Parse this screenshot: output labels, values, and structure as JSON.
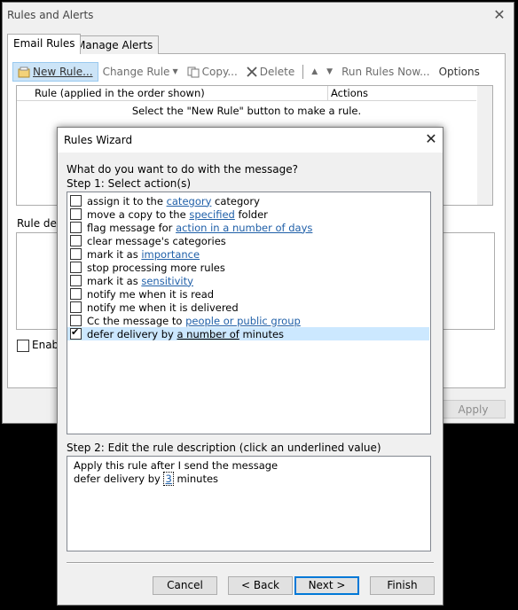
{
  "outer": {
    "title": "Rules and Alerts",
    "close": "✕",
    "tabs": [
      "Email Rules",
      "Manage Alerts"
    ],
    "toolbar": {
      "new_rule": "New Rule...",
      "change_rule": "Change Rule",
      "copy": "Copy...",
      "delete": "Delete",
      "run_rules": "Run Rules Now...",
      "options": "Options"
    },
    "columns": [
      "Rule (applied in the order shown)",
      "Actions"
    ],
    "empty_message": "Select the \"New Rule\" button to make a rule.",
    "rule_desc_label": "Rule des",
    "enable_label": "Enabl",
    "apply": "Apply"
  },
  "wizard": {
    "title": "Rules Wizard",
    "close": "✕",
    "question": "What do you want to do with the message?",
    "step1": "Step 1: Select action(s)",
    "actions": [
      {
        "pre": "assign it to the ",
        "link": "category",
        "post": " category",
        "checked": false
      },
      {
        "pre": "move a copy to the ",
        "link": "specified",
        "post": " folder",
        "checked": false
      },
      {
        "pre": "flag message for ",
        "link": "action in a number of days",
        "post": "",
        "checked": false
      },
      {
        "pre": "clear message's categories",
        "link": "",
        "post": "",
        "checked": false
      },
      {
        "pre": "mark it as ",
        "link": "importance",
        "post": "",
        "checked": false
      },
      {
        "pre": "stop processing more rules",
        "link": "",
        "post": "",
        "checked": false
      },
      {
        "pre": "mark it as ",
        "link": "sensitivity",
        "post": "",
        "checked": false
      },
      {
        "pre": "notify me when it is read",
        "link": "",
        "post": "",
        "checked": false
      },
      {
        "pre": "notify me when it is delivered",
        "link": "",
        "post": "",
        "checked": false
      },
      {
        "pre": "Cc the message to ",
        "link": "people or public group",
        "post": "",
        "checked": false
      },
      {
        "pre": "defer delivery by ",
        "link": "a number of",
        "post": " minutes",
        "checked": true
      }
    ],
    "step2": "Step 2: Edit the rule description (click an underlined value)",
    "desc_line1": "Apply this rule after I send the message",
    "desc_line2_pre": "defer delivery by ",
    "desc_line2_value": "3",
    "desc_line2_post": " minutes",
    "buttons": {
      "cancel": "Cancel",
      "back": "< Back",
      "next": "Next >",
      "finish": "Finish"
    }
  },
  "colors": {
    "link": "#1f5fa8",
    "selection": "#cce8ff",
    "default_button_border": "#0078d7"
  }
}
